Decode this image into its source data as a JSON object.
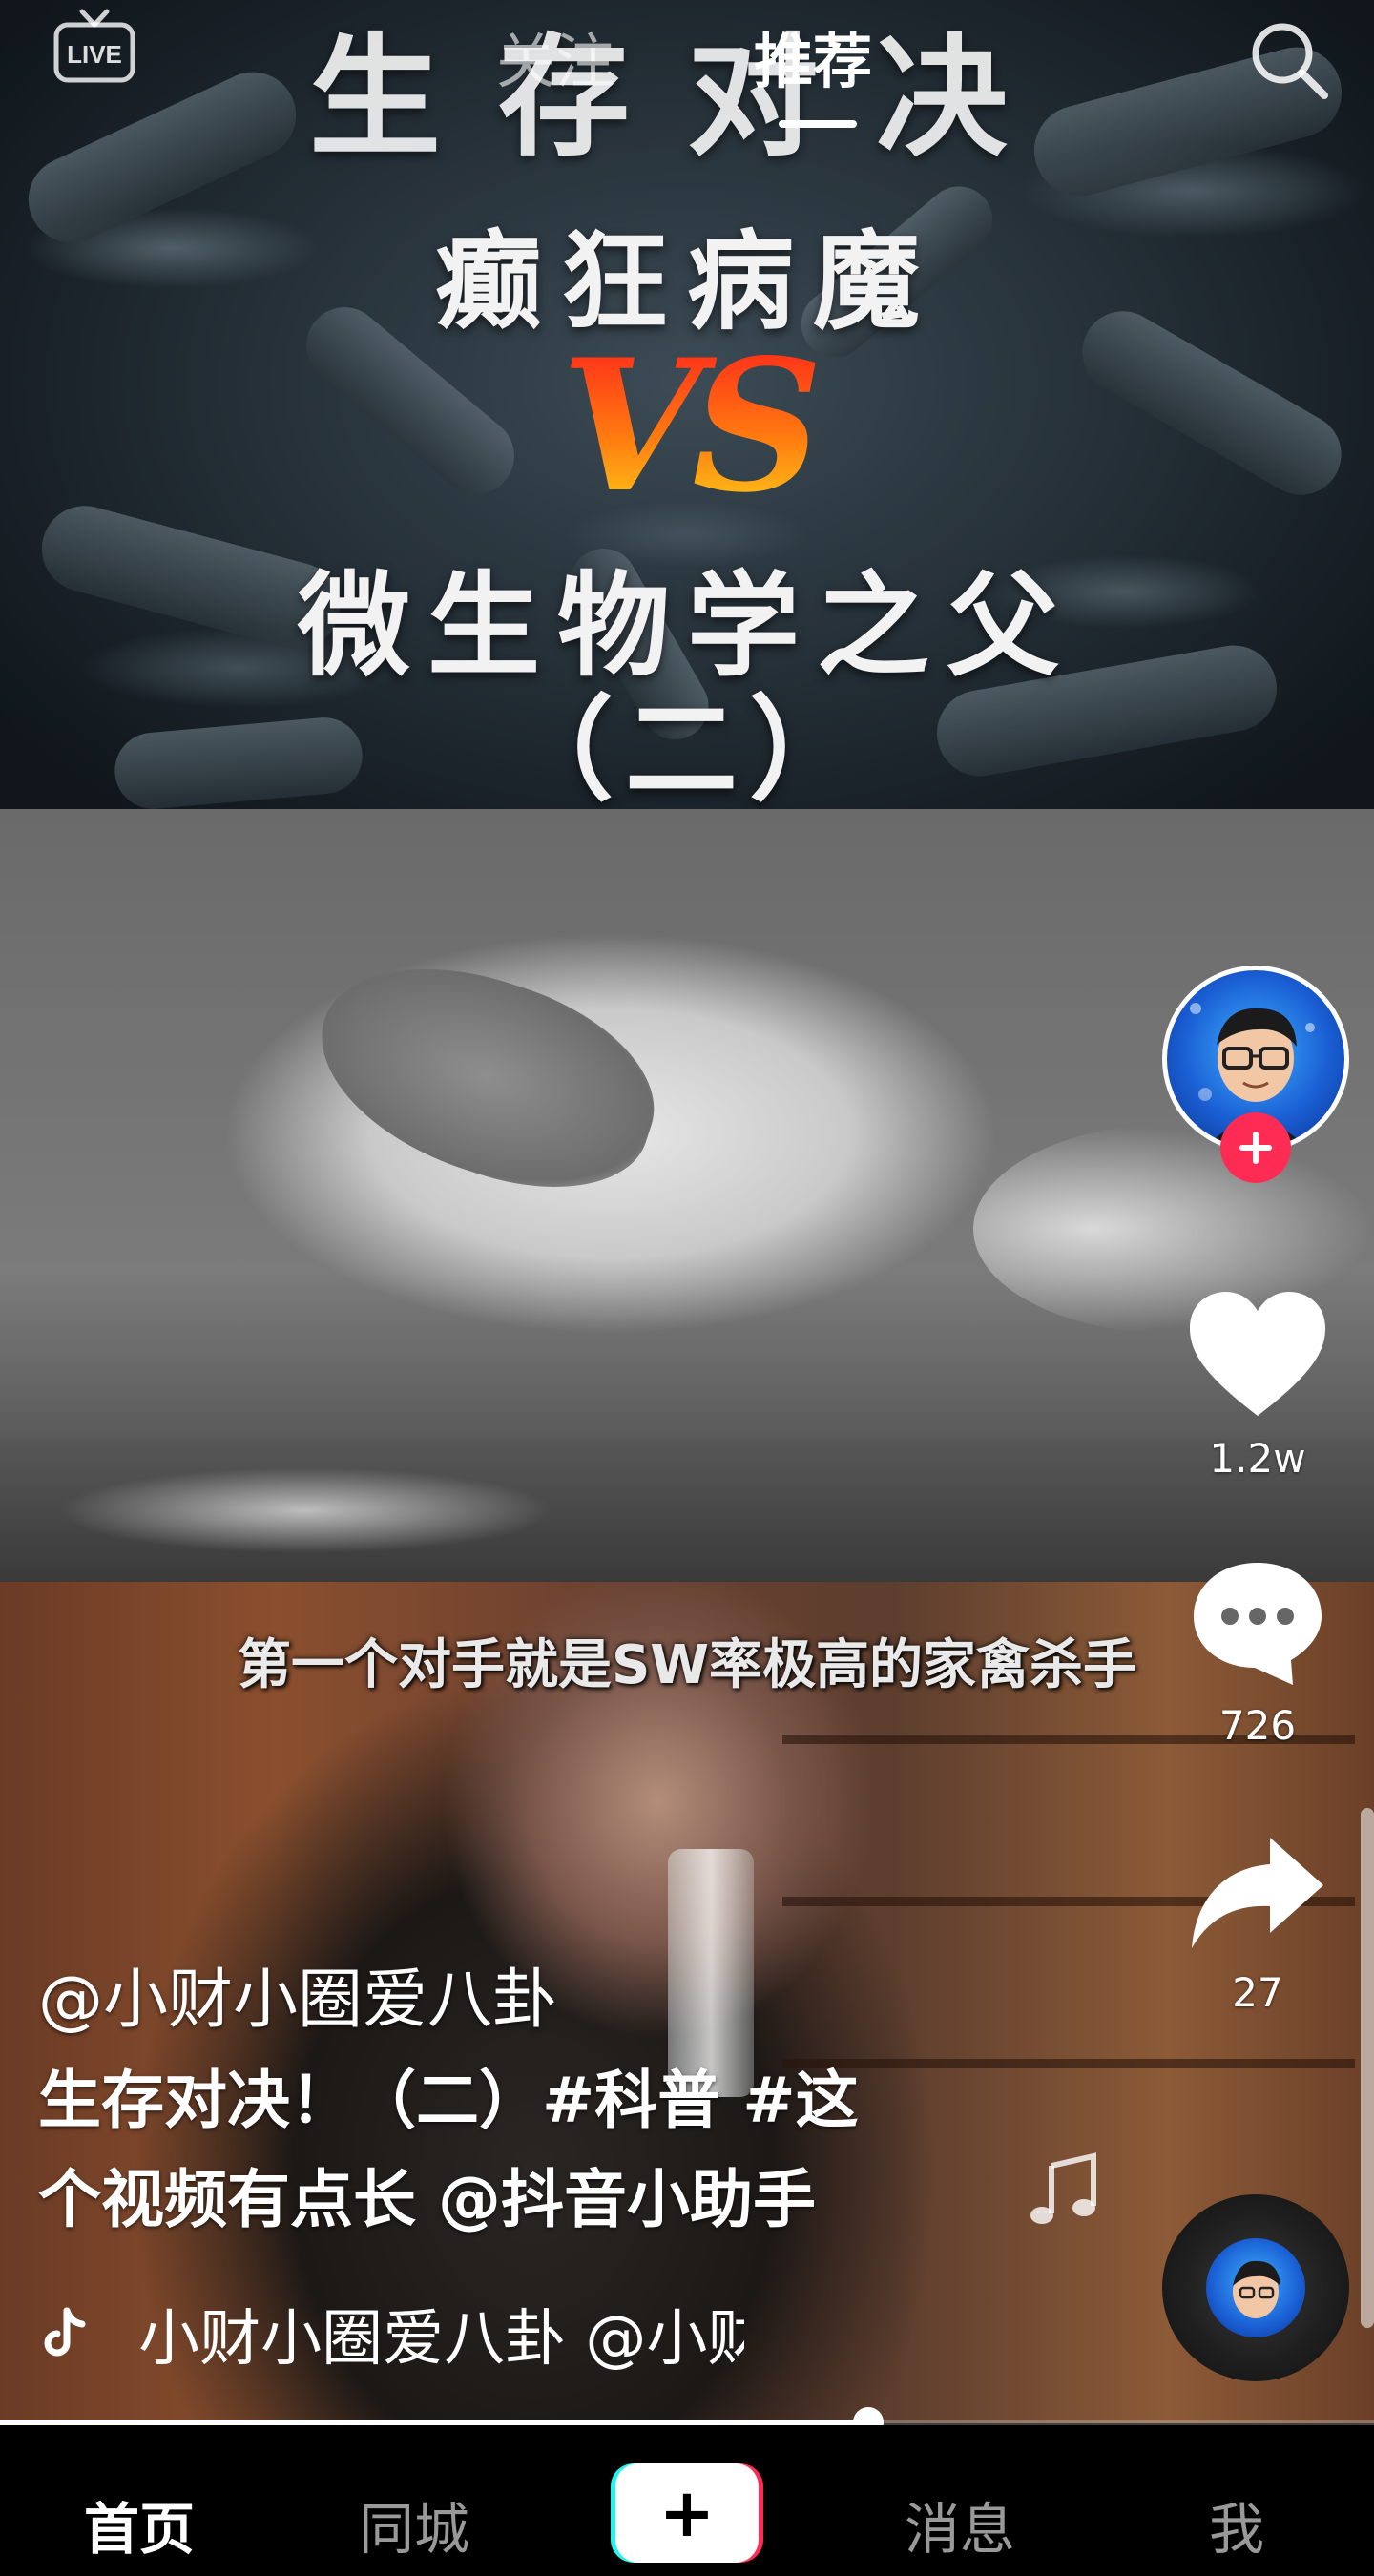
{
  "top_bar": {
    "live_label": "LIVE",
    "tabs": [
      {
        "label": "关注",
        "active": false
      },
      {
        "label": "推荐",
        "active": true
      }
    ]
  },
  "video": {
    "cover_title": "生存对决",
    "cover_line1": "癫狂病魔",
    "cover_vs": "VS",
    "cover_line2": "微生物学之父",
    "cover_line3": "（二）",
    "subtitle": "第一个对手就是SW率极高的家禽杀手"
  },
  "actions": {
    "likes": "1.2w",
    "comments": "726",
    "shares": "27"
  },
  "info": {
    "author_handle": "@小财小圈爱八卦",
    "caption_line1": "生存对决！（二）#科普 #这",
    "caption_line2": "个视频有点长 @抖音小助手",
    "music_text": "小财小圈爱八卦    @小财小圈爱八卦"
  },
  "progress": {
    "fraction": 0.632
  },
  "bottom_nav": {
    "home": "首页",
    "nearby": "同城",
    "create": "+",
    "messages": "消息",
    "me": "我"
  },
  "colors": {
    "accent_red": "#fe2c55",
    "accent_cyan": "#25f4ee",
    "text": "#ffffff"
  },
  "icons": [
    "live-icon",
    "search-icon",
    "heart-icon",
    "comment-icon",
    "share-icon",
    "music-note-icon",
    "tiktok-icon",
    "plus-icon"
  ]
}
